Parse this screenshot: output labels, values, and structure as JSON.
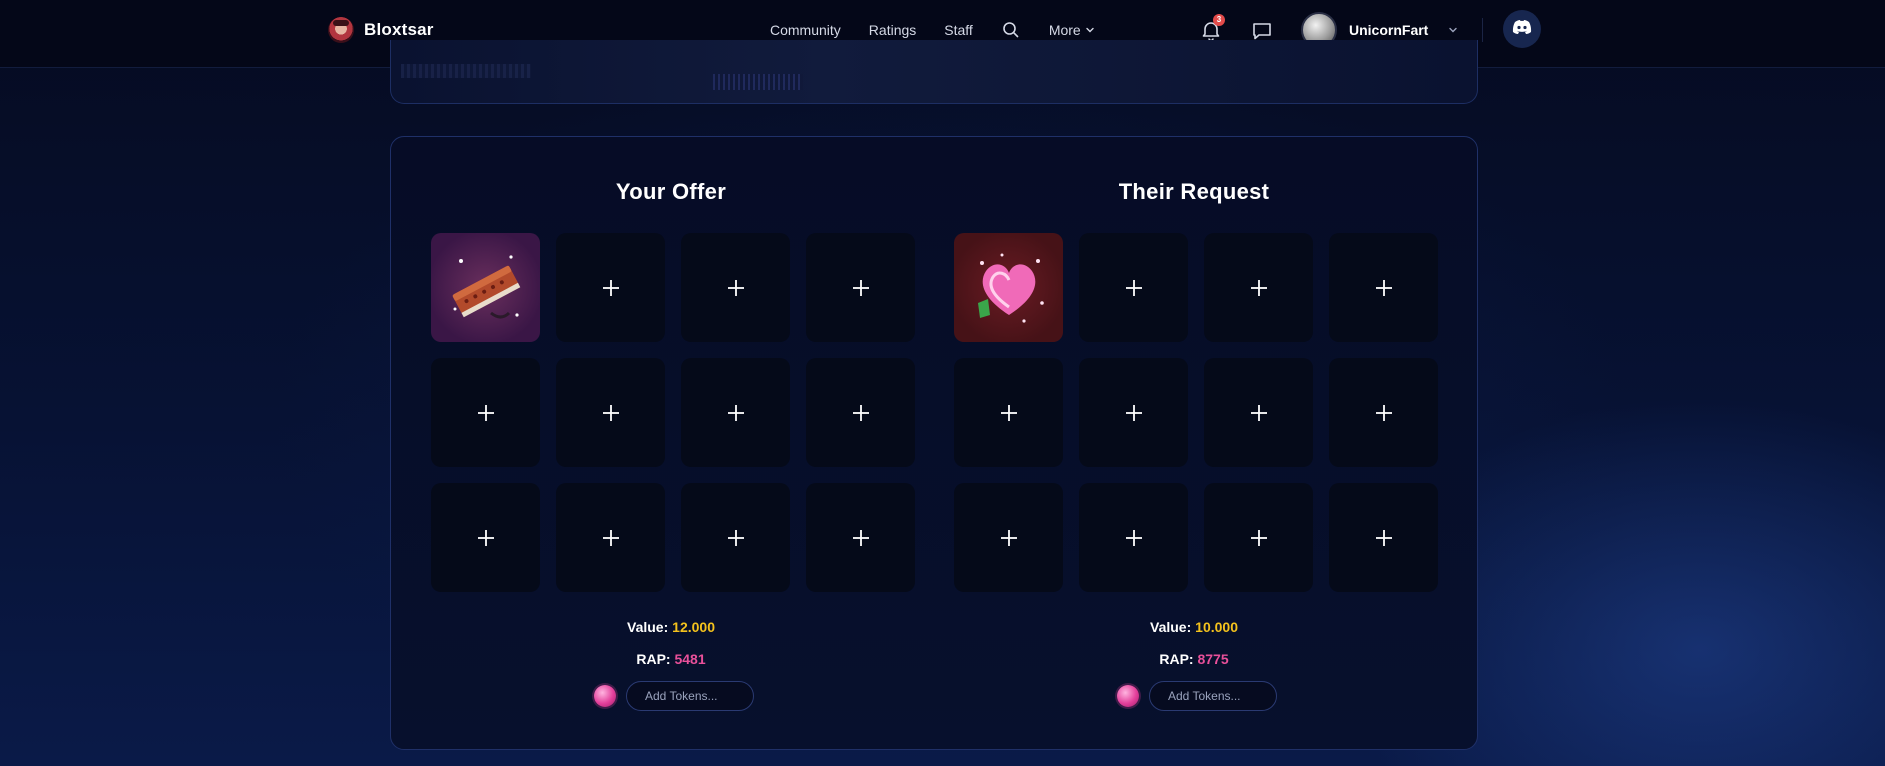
{
  "brand": {
    "name": "Bloxtsar"
  },
  "nav": {
    "items": [
      "Community",
      "Ratings",
      "Staff"
    ],
    "more_label": "More"
  },
  "notifications": {
    "count": "3"
  },
  "user": {
    "name": "UnicornFart"
  },
  "offer": {
    "title": "Your Offer",
    "item_icon": "brick-item",
    "value_label": "Value:",
    "value": "12.000",
    "rap_label": "RAP:",
    "rap": "5481",
    "tokens_placeholder": "Add Tokens..."
  },
  "request": {
    "title": "Their Request",
    "item_icon": "pink-heart-item",
    "value_label": "Value:",
    "value": "10.000",
    "rap_label": "RAP:",
    "rap": "8775",
    "tokens_placeholder": "Add Tokens..."
  },
  "colors": {
    "value": "#f4c21d",
    "rap": "#e9509a",
    "card_border": "#1f3068"
  }
}
